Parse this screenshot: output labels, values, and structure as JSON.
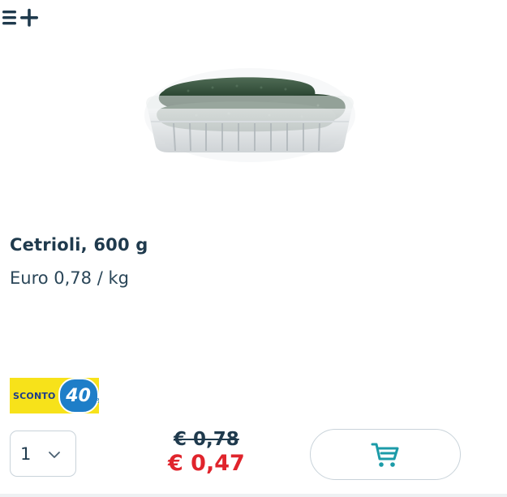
{
  "header": {
    "add_to_list_icon": "list-plus-icon"
  },
  "product": {
    "image_icon": "cucumbers-tray-image",
    "title": "Cetrioli, 600 g",
    "unit_price": "Euro 0,78 / kg"
  },
  "discount": {
    "label": "SCONTO",
    "value": "40",
    "percent_sign": "%"
  },
  "quantity": {
    "selected": "1",
    "chevron_icon": "chevron-down-icon"
  },
  "price": {
    "old": "€ 0,78",
    "new": "€ 0,47"
  },
  "cart": {
    "icon": "cart-icon"
  },
  "colors": {
    "text_primary": "#1f3a4d",
    "price_red": "#e0242c",
    "accent_teal": "#1c9ba8",
    "badge_yellow": "#f7e21a",
    "badge_blue": "#1e7ec8"
  }
}
